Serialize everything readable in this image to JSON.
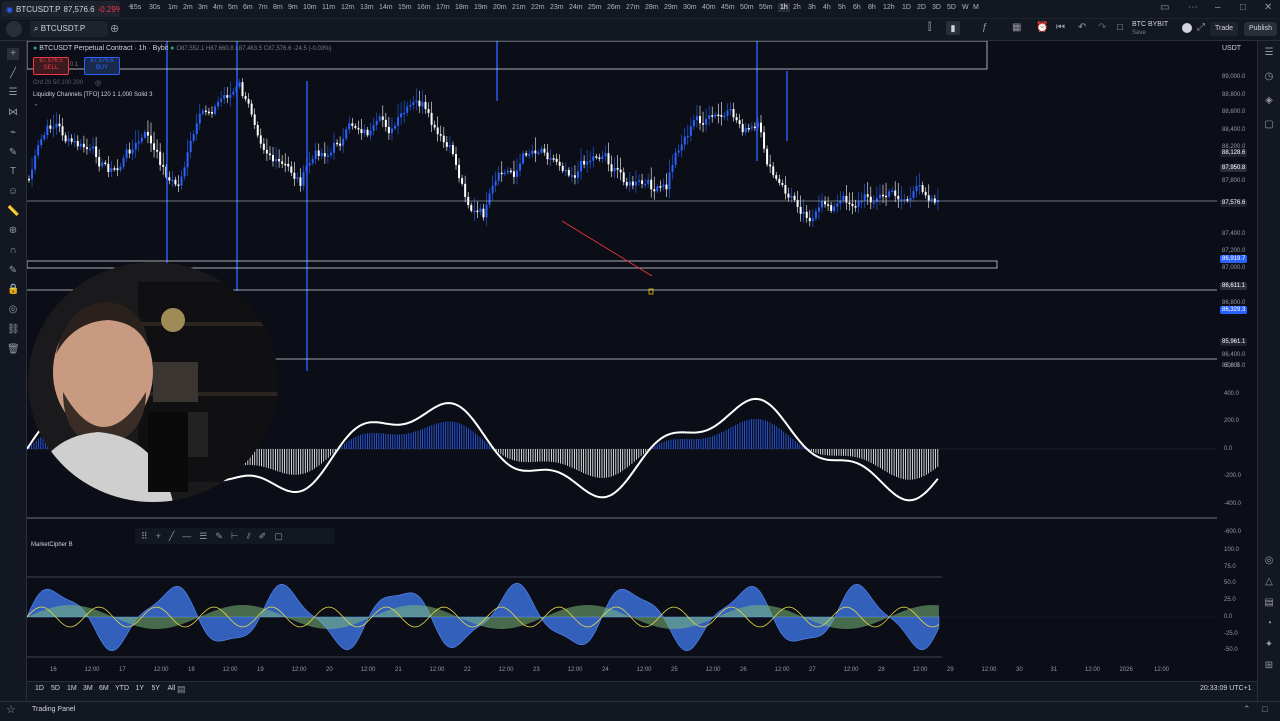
{
  "browser": {
    "tab_title": "BTCUSDT.P",
    "tab_price": "87,576.6",
    "tab_change": "-0.29%",
    "new_tab": "+"
  },
  "toolbar": {
    "symbol": "BTCUSDT.P",
    "timeframes": [
      "15s",
      "30s",
      "1m",
      "2m",
      "3m",
      "4m",
      "5m",
      "6m",
      "7m",
      "8m",
      "9m",
      "10m",
      "11m",
      "12m",
      "13m",
      "14m",
      "15m",
      "16m",
      "17m",
      "18m",
      "19m",
      "20m",
      "21m",
      "22m",
      "23m",
      "24m",
      "25m",
      "26m",
      "27m",
      "28m",
      "29m",
      "30m",
      "40m",
      "45m",
      "50m",
      "55m",
      "1h",
      "2h",
      "3h",
      "4h",
      "5h",
      "6h",
      "8h",
      "12h",
      "1D",
      "2D",
      "3D",
      "5D",
      "W",
      "M"
    ],
    "active_timeframe": "1h",
    "layout_name": "BTC BYBIT",
    "layout_sub": "Save",
    "trade_label": "Trade",
    "publish_label": "Publish"
  },
  "legend": {
    "title": "BTCUSDT Perpetual Contract · 1h · Bybit",
    "ohlc": "O87,552.1 H87,660.8 L87,463.5 C87,576.6 -24.5 (-0.03%)",
    "sell_price": "87,576.5",
    "sell_label": "SELL",
    "spread": "0.1",
    "buy_price": "87,576.6",
    "buy_label": "BUY",
    "ma_row": "Ord 20 50 100 200",
    "indicator": "Liquidity Channels [TFO] 120 1 1,000 Solid 3",
    "sub_indicator": "MarketCipher B"
  },
  "price_axis": {
    "currency": "USDT",
    "labels": [
      "89,000.0",
      "88,800.0",
      "88,600.0",
      "88,400.0",
      "88,200.0",
      "87,800.0",
      "87,400.0",
      "87,200.0",
      "87,000.0",
      "86,800.0",
      "86,400.0",
      "85,800.0"
    ],
    "tags": [
      {
        "text": "88,128.6",
        "color": "#1e222d"
      },
      {
        "text": "87,950.8",
        "color": "#2a2e39"
      },
      {
        "text": "87,576.6",
        "color": "#1e222d"
      },
      {
        "text": "86,919.7",
        "color": "#2962ff"
      },
      {
        "text": "86,611.1",
        "color": "#2a2e39"
      },
      {
        "text": "86,329.3",
        "color": "#2962ff"
      },
      {
        "text": "85,961.1",
        "color": "#1e222d"
      }
    ]
  },
  "osc_axis": {
    "labels": [
      "600.0",
      "400.0",
      "200.0",
      "0.0",
      "-200.0",
      "-400.0",
      "-600.0"
    ]
  },
  "mcb_axis": {
    "labels": [
      "100.0",
      "75.0",
      "50.0",
      "25.0",
      "0.0",
      "-25.0",
      "-50.0"
    ]
  },
  "time_axis": {
    "labels": [
      "16",
      "12:00",
      "17",
      "12:00",
      "18",
      "12:00",
      "19",
      "12:00",
      "20",
      "12:00",
      "21",
      "12:00",
      "22",
      "12:00",
      "23",
      "12:00",
      "24",
      "12:00",
      "25",
      "12:00",
      "26",
      "12:00",
      "27",
      "12:00",
      "28",
      "12:00",
      "29",
      "12:00",
      "30",
      "31",
      "12:00",
      "2026",
      "12:00"
    ]
  },
  "bottom": {
    "ranges": [
      "1D",
      "5D",
      "1M",
      "3M",
      "6M",
      "YTD",
      "1Y",
      "5Y",
      "All"
    ],
    "clock": "20:33:09 UTC+1",
    "panel": "Trading Panel"
  },
  "colors": {
    "accent": "#2962ff",
    "bull": "#2962ff",
    "bear": "#ffffff",
    "down": "#f23645",
    "bg": "#0b0e16"
  }
}
